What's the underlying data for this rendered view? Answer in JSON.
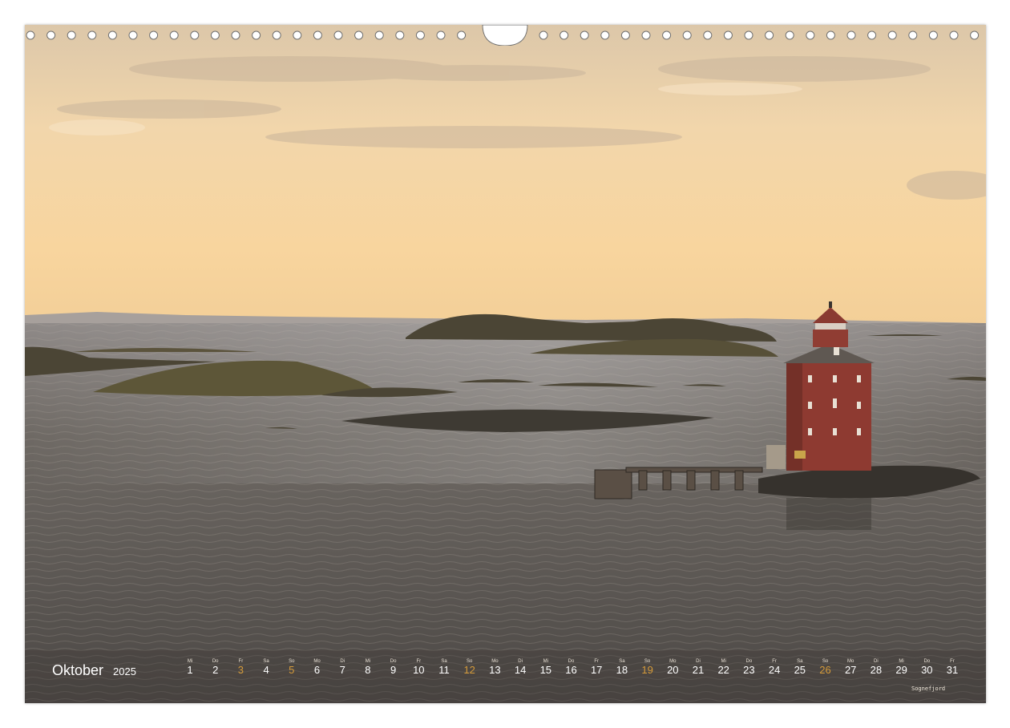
{
  "calendar": {
    "month": "Oktober",
    "year": "2025",
    "caption": "Sognefjord",
    "weekend_color": "#d49a3a",
    "days": [
      {
        "wd": "Mi",
        "n": "1"
      },
      {
        "wd": "Do",
        "n": "2"
      },
      {
        "wd": "Fr",
        "n": "3",
        "we": true
      },
      {
        "wd": "Sa",
        "n": "4"
      },
      {
        "wd": "So",
        "n": "5",
        "we": true
      },
      {
        "wd": "Mo",
        "n": "6"
      },
      {
        "wd": "Di",
        "n": "7"
      },
      {
        "wd": "Mi",
        "n": "8"
      },
      {
        "wd": "Do",
        "n": "9"
      },
      {
        "wd": "Fr",
        "n": "10"
      },
      {
        "wd": "Sa",
        "n": "11"
      },
      {
        "wd": "So",
        "n": "12",
        "we": true
      },
      {
        "wd": "Mo",
        "n": "13"
      },
      {
        "wd": "Di",
        "n": "14"
      },
      {
        "wd": "Mi",
        "n": "15"
      },
      {
        "wd": "Do",
        "n": "16"
      },
      {
        "wd": "Fr",
        "n": "17"
      },
      {
        "wd": "Sa",
        "n": "18"
      },
      {
        "wd": "So",
        "n": "19",
        "we": true
      },
      {
        "wd": "Mo",
        "n": "20"
      },
      {
        "wd": "Di",
        "n": "21"
      },
      {
        "wd": "Mi",
        "n": "22"
      },
      {
        "wd": "Do",
        "n": "23"
      },
      {
        "wd": "Fr",
        "n": "24"
      },
      {
        "wd": "Sa",
        "n": "25"
      },
      {
        "wd": "So",
        "n": "26",
        "we": true
      },
      {
        "wd": "Mo",
        "n": "27"
      },
      {
        "wd": "Di",
        "n": "28"
      },
      {
        "wd": "Mi",
        "n": "29"
      },
      {
        "wd": "Do",
        "n": "30"
      },
      {
        "wd": "Fr",
        "n": "31"
      }
    ]
  }
}
